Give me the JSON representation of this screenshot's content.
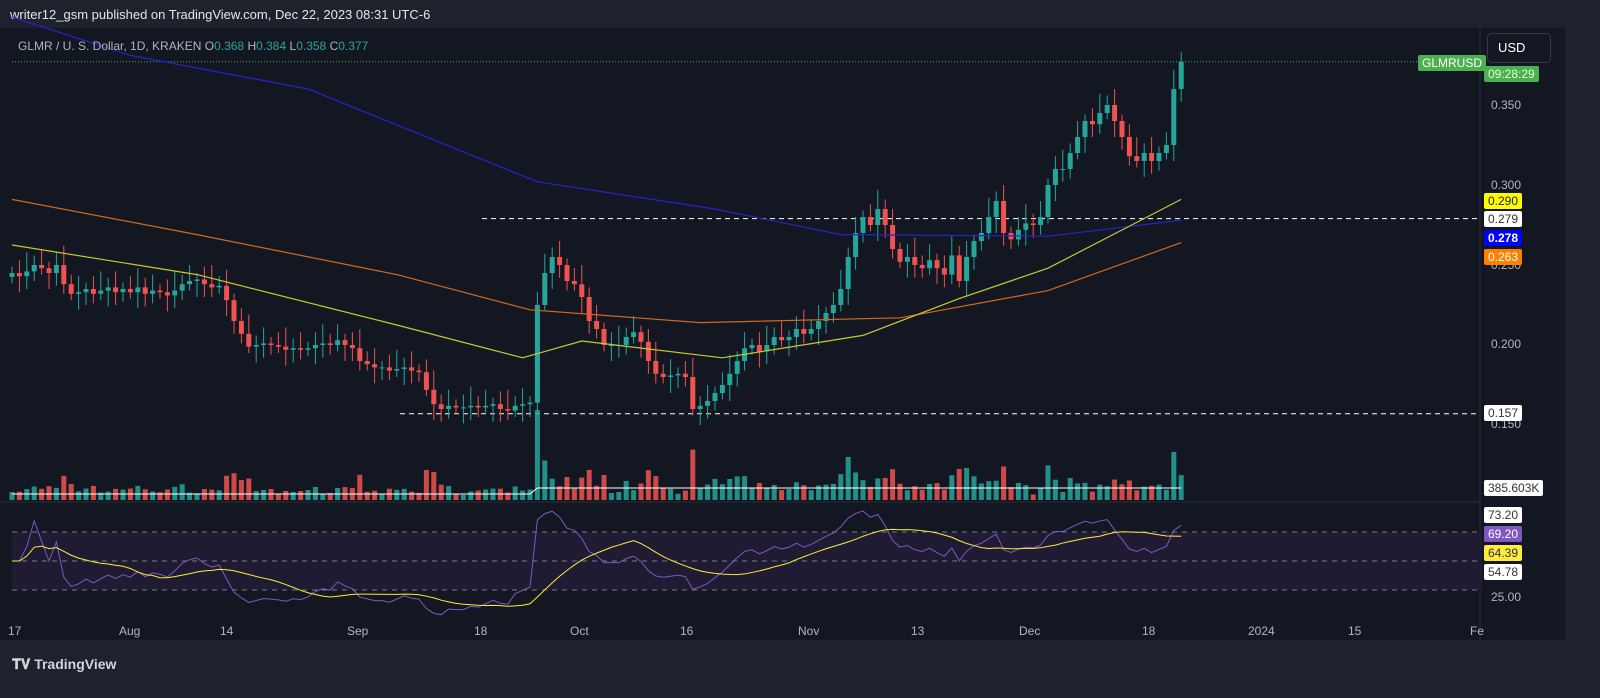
{
  "header": {
    "published": "writer12_gsm published on TradingView.com, Dec 22, 2023 08:31 UTC-6"
  },
  "legend": {
    "symbol": "GLMR / U. S. Dollar, 1D, KRAKEN",
    "o_label": "O",
    "o": "0.368",
    "h_label": "H",
    "h": "0.384",
    "l_label": "L",
    "l": "0.358",
    "c_label": "C",
    "c": "0.377"
  },
  "currency_button": "USD",
  "labels": {
    "ticker": "GLMRUSD",
    "countdown": "09:28:29",
    "ma50": "0.290",
    "level_upper": "0.279",
    "ma200": "0.278",
    "ma100": "0.263",
    "level_lower": "0.157",
    "volume": "385.603K",
    "rsi_upper": "73.20",
    "rsi": "69.20",
    "rsi_ma": "64.39",
    "rsi_lower": "54.78"
  },
  "price_axis": [
    "0.350",
    "0.300",
    "0.250",
    "0.200",
    "0.150"
  ],
  "rsi_axis": [
    "25.00"
  ],
  "time_axis": [
    "17",
    "Aug",
    "14",
    "Sep",
    "18",
    "Oct",
    "16",
    "Nov",
    "13",
    "Dec",
    "18",
    "2024",
    "15",
    "Fe"
  ],
  "footer": {
    "brand": "TradingView"
  },
  "colors": {
    "up": "#26a69a",
    "down": "#ef5350",
    "ma50": "#c8c832",
    "ma100": "#d2691e",
    "ma200": "#2424c8",
    "rsi": "#7e57c2"
  },
  "chart_data": {
    "type": "candlestick",
    "start": "2023-07-17",
    "interval": "1D",
    "closes": [
      0.245,
      0.243,
      0.246,
      0.25,
      0.248,
      0.245,
      0.25,
      0.238,
      0.232,
      0.233,
      0.235,
      0.232,
      0.234,
      0.236,
      0.233,
      0.235,
      0.233,
      0.236,
      0.232,
      0.234,
      0.233,
      0.231,
      0.234,
      0.238,
      0.24,
      0.241,
      0.238,
      0.236,
      0.237,
      0.228,
      0.215,
      0.207,
      0.199,
      0.2,
      0.201,
      0.2,
      0.199,
      0.197,
      0.198,
      0.197,
      0.198,
      0.2,
      0.201,
      0.2,
      0.203,
      0.2,
      0.198,
      0.19,
      0.188,
      0.186,
      0.186,
      0.184,
      0.185,
      0.186,
      0.184,
      0.183,
      0.172,
      0.163,
      0.16,
      0.162,
      0.161,
      0.161,
      0.162,
      0.161,
      0.162,
      0.163,
      0.16,
      0.159,
      0.162,
      0.163,
      0.164,
      0.225,
      0.245,
      0.255,
      0.25,
      0.24,
      0.238,
      0.23,
      0.215,
      0.21,
      0.2,
      0.2,
      0.2,
      0.205,
      0.208,
      0.202,
      0.19,
      0.182,
      0.18,
      0.181,
      0.182,
      0.18,
      0.16,
      0.162,
      0.165,
      0.17,
      0.175,
      0.182,
      0.19,
      0.198,
      0.2,
      0.196,
      0.2,
      0.205,
      0.203,
      0.205,
      0.21,
      0.207,
      0.21,
      0.215,
      0.22,
      0.225,
      0.235,
      0.255,
      0.27,
      0.28,
      0.275,
      0.285,
      0.275,
      0.26,
      0.252,
      0.255,
      0.25,
      0.248,
      0.253,
      0.248,
      0.244,
      0.256,
      0.24,
      0.255,
      0.265,
      0.27,
      0.28,
      0.29,
      0.27,
      0.266,
      0.272,
      0.276,
      0.275,
      0.28,
      0.3,
      0.31,
      0.31,
      0.32,
      0.33,
      0.34,
      0.338,
      0.345,
      0.35,
      0.34,
      0.33,
      0.318,
      0.315,
      0.32,
      0.315,
      0.32,
      0.325,
      0.36,
      0.377
    ],
    "ma200": [
      [
        0,
        0.405
      ],
      [
        16,
        0.381
      ],
      [
        40,
        0.36
      ],
      [
        71,
        0.302
      ],
      [
        95,
        0.285
      ],
      [
        112,
        0.269
      ],
      [
        140,
        0.268
      ],
      [
        158,
        0.278
      ]
    ],
    "ma100": [
      [
        0,
        0.291
      ],
      [
        25,
        0.269
      ],
      [
        52,
        0.244
      ],
      [
        70,
        0.222
      ],
      [
        93,
        0.214
      ],
      [
        120,
        0.217
      ],
      [
        140,
        0.234
      ],
      [
        158,
        0.264
      ]
    ],
    "ma50": [
      [
        0,
        0.2625
      ],
      [
        25,
        0.244
      ],
      [
        52,
        0.2125
      ],
      [
        69,
        0.192
      ],
      [
        77,
        0.2025
      ],
      [
        96,
        0.192
      ],
      [
        115,
        0.206
      ],
      [
        128,
        0.229
      ],
      [
        140,
        0.248
      ],
      [
        158,
        0.291
      ]
    ],
    "levels": [
      0.279,
      0.157
    ],
    "ylim": [
      0.14,
      0.41
    ],
    "rsi_bands": [
      70,
      50,
      30
    ]
  }
}
